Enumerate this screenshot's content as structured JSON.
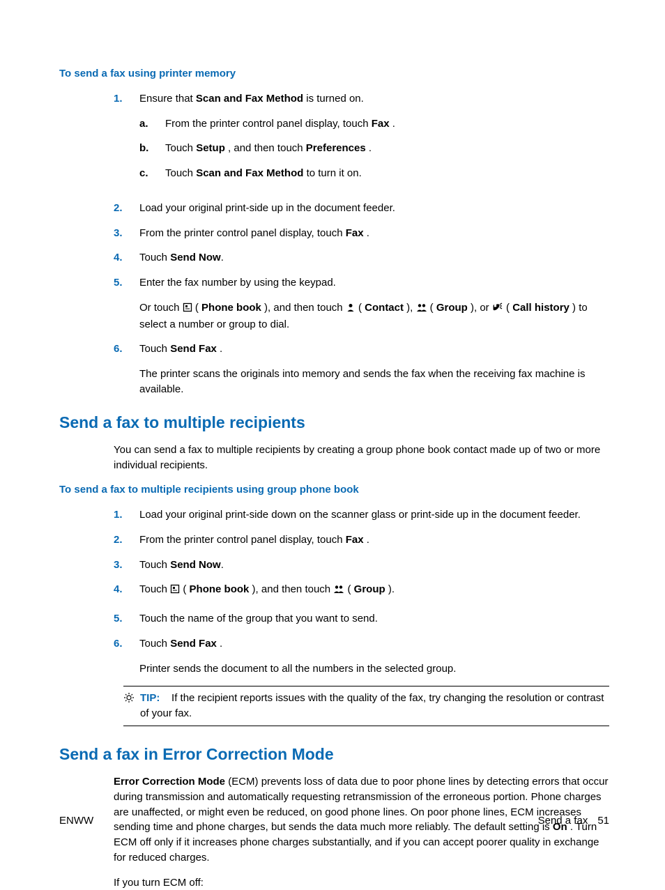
{
  "proc1": {
    "heading": "To send a fax using printer memory",
    "items": {
      "1": {
        "num": "1.",
        "text_pre": "Ensure that ",
        "bold": "Scan and Fax Method",
        "text_post": " is turned on.",
        "sub": {
          "a": {
            "num": "a.",
            "pre": "From the printer control panel display, touch ",
            "bold": "Fax",
            "post": " ."
          },
          "b": {
            "num": "b.",
            "pre": "Touch ",
            "bold1": "Setup",
            "mid": " , and then touch ",
            "bold2": "Preferences",
            "post": " ."
          },
          "c": {
            "num": "c.",
            "pre": "Touch ",
            "bold": "Scan and Fax Method",
            "post": " to turn it on."
          }
        }
      },
      "2": {
        "num": "2.",
        "text": "Load your original print-side up in the document feeder."
      },
      "3": {
        "num": "3.",
        "pre": "From the printer control panel display, touch ",
        "bold": "Fax",
        "post": " ."
      },
      "4": {
        "num": "4.",
        "pre": "Touch ",
        "bold": "Send Now",
        "post": "."
      },
      "5": {
        "num": "5.",
        "text": "Enter the fax number by using the keypad.",
        "para2": {
          "t1": "Or touch ",
          "pb": "Phone book",
          "t2": " ), and then touch  ",
          "contact": "Contact",
          "t3": " ),  ",
          "group": "Group",
          "t4": " ), or ",
          "callhist": "Call history",
          "t5": " ) to select a number or group to dial."
        }
      },
      "6": {
        "num": "6.",
        "pre": "Touch ",
        "bold": "Send Fax",
        "post": " .",
        "after": "The printer scans the originals into memory and sends the fax when the receiving fax machine is available."
      }
    }
  },
  "section2": {
    "heading": "Send a fax to multiple recipients",
    "intro": "You can send a fax to multiple recipients by creating a group phone book contact made up of two or more individual recipients.",
    "proc_heading": "To send a fax to multiple recipients using group phone book",
    "items": {
      "1": {
        "num": "1.",
        "text": "Load your original print-side down on the scanner glass or print-side up in the document feeder."
      },
      "2": {
        "num": "2.",
        "pre": "From the printer control panel display, touch ",
        "bold": "Fax",
        "post": " ."
      },
      "3": {
        "num": "3.",
        "pre": "Touch ",
        "bold": "Send Now",
        "post": "."
      },
      "4": {
        "num": "4.",
        "t1": "Touch ",
        "pb": "Phone book",
        "t2": " ), and then touch  ",
        "group": "Group",
        "t3": " )."
      },
      "5": {
        "num": "5.",
        "text": "Touch the name of the group that you want to send."
      },
      "6": {
        "num": "6.",
        "pre": "Touch ",
        "bold": "Send Fax",
        "post": " .",
        "after": "Printer sends the document to all the numbers in the selected group."
      }
    },
    "tip": {
      "label": "TIP:",
      "text": "If the recipient reports issues with the quality of the fax, try changing the resolution or contrast of your fax."
    }
  },
  "section3": {
    "heading": "Send a fax in Error Correction Mode",
    "para1": {
      "bold1": "Error Correction Mode",
      "t1": " (ECM) prevents loss of data due to poor phone lines by detecting errors that occur during transmission and automatically requesting retransmission of the erroneous portion. Phone charges are unaffected, or might even be reduced, on good phone lines. On poor phone lines, ECM increases sending time and phone charges, but sends the data much more reliably. The default setting is ",
      "bold2": "On",
      "t2": " . Turn ECM off only if it increases phone charges substantially, and if you can accept poorer quality in exchange for reduced charges."
    },
    "para2": "If you turn ECM off:"
  },
  "footer": {
    "left": "ENWW",
    "right_label": "Send a fax",
    "page": "51"
  }
}
